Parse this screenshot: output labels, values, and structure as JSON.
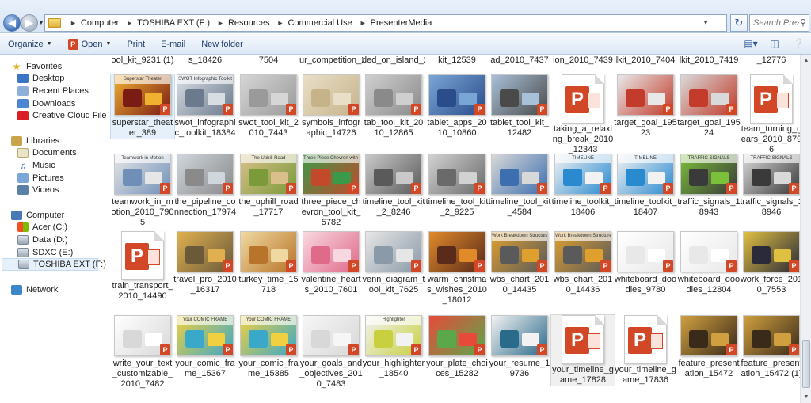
{
  "address": {
    "crumbs": [
      "Computer",
      "TOSHIBA EXT (F:)",
      "Resources",
      "Commercial Use",
      "PresenterMedia"
    ],
    "search_placeholder": "Search Pres..."
  },
  "toolbar": {
    "organize": "Organize",
    "open": "Open",
    "print": "Print",
    "email": "E-mail",
    "new_folder": "New folder"
  },
  "navpane": {
    "favorites": "Favorites",
    "favorite_items": [
      "Desktop",
      "Recent Places",
      "Downloads",
      "Creative Cloud Files"
    ],
    "libraries": "Libraries",
    "library_items": [
      "Documents",
      "Music",
      "Pictures",
      "Videos"
    ],
    "computer": "Computer",
    "computer_items": [
      "Acer (C:)",
      "Data (D:)",
      "SDXC (E:)",
      "TOSHIBA EXT (F:)"
    ],
    "network": "Network"
  },
  "top_row_labels": [
    "ool_kit_9231 (1)",
    "s_18426",
    "7504",
    "ur_competition_2010_7426",
    "ded_on_island_2010_9453",
    "kit_12539",
    "ad_2010_7437",
    "ion_2010_7439",
    "lkit_2010_7404",
    "lkit_2010_7419",
    "_12776"
  ],
  "files": [
    [
      {
        "name": "superstar_theater_389",
        "kind": "thumb",
        "color1": "#7a1b14",
        "color2": "#f0b030",
        "strip": "Superstar Theater"
      },
      {
        "name": "swot_infographic_toolkit_18384",
        "kind": "thumb",
        "color1": "#6b7a8c",
        "color2": "#d8dde4",
        "strip": "SWOT Infographic Toolkit"
      },
      {
        "name": "swot_tool_kit_2010_7443",
        "kind": "thumb",
        "color1": "#9a9a9a",
        "color2": "#d6d6d6",
        "strip": ""
      },
      {
        "name": "symbols_infographic_14726",
        "kind": "thumb",
        "color1": "#c7b38a",
        "color2": "#e9dfc8",
        "strip": ""
      },
      {
        "name": "tab_tool_kit_2010_12865",
        "kind": "thumb",
        "color1": "#8a8a8a",
        "color2": "#cfcfcf",
        "strip": ""
      },
      {
        "name": "tablet_apps_2010_10860",
        "kind": "thumb",
        "color1": "#2a4c8a",
        "color2": "#7aa6d6",
        "strip": ""
      },
      {
        "name": "tablet_tool_kit_12482",
        "kind": "thumb",
        "color1": "#4a4a4a",
        "color2": "#a8c0d8",
        "strip": ""
      },
      {
        "name": "taking_a_relaxing_break_2010_12343",
        "kind": "ppt"
      },
      {
        "name": "target_goal_19523",
        "kind": "thumb",
        "color1": "#c23b2b",
        "color2": "#e8e8e8",
        "strip": ""
      },
      {
        "name": "target_goal_19524",
        "kind": "thumb",
        "color1": "#c23b2b",
        "color2": "#d9d9d9",
        "strip": ""
      },
      {
        "name": "team_turning_gears_2010_8796",
        "kind": "ppt"
      }
    ],
    [
      {
        "name": "teamwork_in_motion_2010_7905",
        "kind": "thumb",
        "color1": "#6f8fb8",
        "color2": "#e6e6e6",
        "strip": "Teamwork in Motion"
      },
      {
        "name": "the_pipeline_connection_17974",
        "kind": "thumb",
        "color1": "#8a8a8a",
        "color2": "#cfd6dc",
        "strip": ""
      },
      {
        "name": "the_uphill_road_17717",
        "kind": "thumb",
        "color1": "#7b9a3a",
        "color2": "#d9c08a",
        "strip": "The Uphill Road"
      },
      {
        "name": "three_piece_chevron_tool_kit_5782",
        "kind": "thumb",
        "color1": "#c24a2b",
        "color2": "#3b9a4a",
        "strip": "Three Piece Chevron with 10 Figures"
      },
      {
        "name": "timeline_tool_kit_2_8246",
        "kind": "thumb",
        "color1": "#5a5a5a",
        "color2": "#c9c9c9",
        "strip": ""
      },
      {
        "name": "timeline_tool_kit_2_9225",
        "kind": "thumb",
        "color1": "#6a6a6a",
        "color2": "#d2d2d2",
        "strip": ""
      },
      {
        "name": "timeline_tool_kit_4584",
        "kind": "thumb",
        "color1": "#3d6fb0",
        "color2": "#d8d8d8",
        "strip": ""
      },
      {
        "name": "timeline_toolkit_18406",
        "kind": "thumb",
        "color1": "#2a8ad0",
        "color2": "#f2f2f2",
        "strip": "TIMELINE"
      },
      {
        "name": "timeline_toolkit_18407",
        "kind": "thumb",
        "color1": "#2a8ad0",
        "color2": "#f2f2f2",
        "strip": "TIMELINE"
      },
      {
        "name": "traffic_signals_18943",
        "kind": "thumb",
        "color1": "#3a3a3a",
        "color2": "#7cbf3a",
        "strip": "TRAFFIC SIGNALS"
      },
      {
        "name": "traffic_signals_18946",
        "kind": "thumb",
        "color1": "#3a3a3a",
        "color2": "#d9d9d9",
        "strip": "TRAFFIC SIGNALS"
      }
    ],
    [
      {
        "name": "train_transport_2010_14490",
        "kind": "ppt"
      },
      {
        "name": "travel_pro_2010_16317",
        "kind": "thumb",
        "color1": "#6a5a3a",
        "color2": "#e0b050",
        "strip": ""
      },
      {
        "name": "turkey_time_15718",
        "kind": "thumb",
        "color1": "#b8742a",
        "color2": "#f0d9a0",
        "strip": ""
      },
      {
        "name": "valentine_hearts_2010_7601",
        "kind": "thumb",
        "color1": "#e06a8a",
        "color2": "#f8d8e0",
        "strip": ""
      },
      {
        "name": "venn_diagram_tool_kit_7625",
        "kind": "thumb",
        "color1": "#8a9aa8",
        "color2": "#e6e6e6",
        "strip": ""
      },
      {
        "name": "warm_christmas_wishes_2010_18012",
        "kind": "thumb",
        "color1": "#5a2a1a",
        "color2": "#e08a2a",
        "strip": ""
      },
      {
        "name": "wbs_chart_2010_14435",
        "kind": "thumb",
        "color1": "#5a5a5a",
        "color2": "#e0a030",
        "strip": "Work Breakdown Structure"
      },
      {
        "name": "wbs_chart_2010_14436",
        "kind": "thumb",
        "color1": "#5a5a5a",
        "color2": "#e0a030",
        "strip": "Work Breakdown Structure"
      },
      {
        "name": "whiteboard_doodles_9780",
        "kind": "thumb",
        "color1": "#e8e8e8",
        "color2": "#ffffff",
        "strip": ""
      },
      {
        "name": "whiteboard_doodles_12804",
        "kind": "thumb",
        "color1": "#e8e8e8",
        "color2": "#ffffff",
        "strip": ""
      },
      {
        "name": "work_force_2010_7553",
        "kind": "thumb",
        "color1": "#2a2a3a",
        "color2": "#e0c040",
        "strip": ""
      }
    ],
    [
      {
        "name": "write_your_text_customizable_2010_7482",
        "kind": "thumb",
        "color1": "#d8d8d8",
        "color2": "#ffffff",
        "strip": ""
      },
      {
        "name": "your_comic_frame_15367",
        "kind": "thumb",
        "color1": "#3aa8c8",
        "color2": "#f0d040",
        "strip": "Your COMIC FRAME"
      },
      {
        "name": "your_comic_frame_15385",
        "kind": "thumb",
        "color1": "#3aa8c8",
        "color2": "#f0d040",
        "strip": "Your COMIC FRAME"
      },
      {
        "name": "your_goals_and_objectives_2010_7483",
        "kind": "thumb",
        "color1": "#d8d8d8",
        "color2": "#f6f6f6",
        "strip": ""
      },
      {
        "name": "your_highlighter_18540",
        "kind": "thumb",
        "color1": "#c8d040",
        "color2": "#f2f2f2",
        "strip": "Highlighter"
      },
      {
        "name": "your_plate_choices_15282",
        "kind": "thumb",
        "color1": "#5aa84a",
        "color2": "#e84a3a",
        "strip": ""
      },
      {
        "name": "your_resume_19736",
        "kind": "thumb",
        "color1": "#2a6a8a",
        "color2": "#f2f2f2",
        "strip": ""
      },
      {
        "name": "your_timeline_game_17828",
        "kind": "ppt",
        "state": "hover"
      },
      {
        "name": "your_timeline_game_17836",
        "kind": "ppt"
      },
      {
        "name": "feature_presentation_15472",
        "kind": "thumb",
        "color1": "#3a2a1a",
        "color2": "#d0a040",
        "strip": ""
      },
      {
        "name": "feature_presentation_15472 (1)",
        "kind": "thumb",
        "color1": "#3a2a1a",
        "color2": "#d0a040",
        "strip": ""
      }
    ]
  ]
}
